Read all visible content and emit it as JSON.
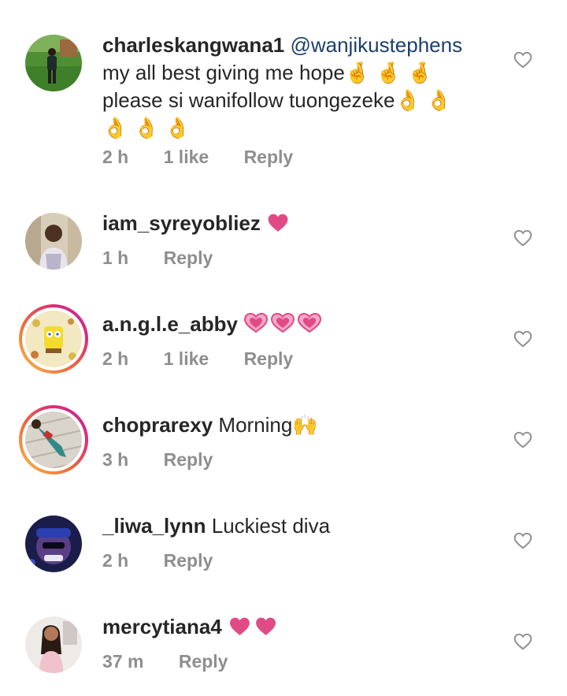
{
  "comments": [
    {
      "username": "charleskangwana1",
      "mention": "@wanjikustephens",
      "lines": [
        "my all best giving me hope🤞 🤞 🤞",
        "please si wanifollow tuongezeke👌 👌",
        "👌 👌 👌"
      ],
      "time": "2 h",
      "likes": "1 like",
      "reply": "Reply"
    },
    {
      "username": "iam_syreyobliez",
      "emoji": "heart",
      "time": "1 h",
      "reply": "Reply"
    },
    {
      "username": "a.n.g.l.e_abby",
      "emoji": "sparkling-heart",
      "time": "2 h",
      "likes": "1 like",
      "reply": "Reply"
    },
    {
      "username": "choprarexy",
      "text": "Morning🙌",
      "time": "3 h",
      "reply": "Reply"
    },
    {
      "username": "_liwa_lynn",
      "text": "Luckiest diva",
      "time": "2 h",
      "reply": "Reply"
    },
    {
      "username": "mercytiana4",
      "emoji": "heart",
      "time": "37 m",
      "reply": "Reply"
    }
  ],
  "icons": {
    "like": "heart-outline-icon",
    "emoji_heart_color": "#e04b86"
  },
  "colors": {
    "text": "#262626",
    "meta": "#8e8e8e",
    "mention": "#1c3f6e",
    "heart_outline": "#8e8e8e"
  }
}
